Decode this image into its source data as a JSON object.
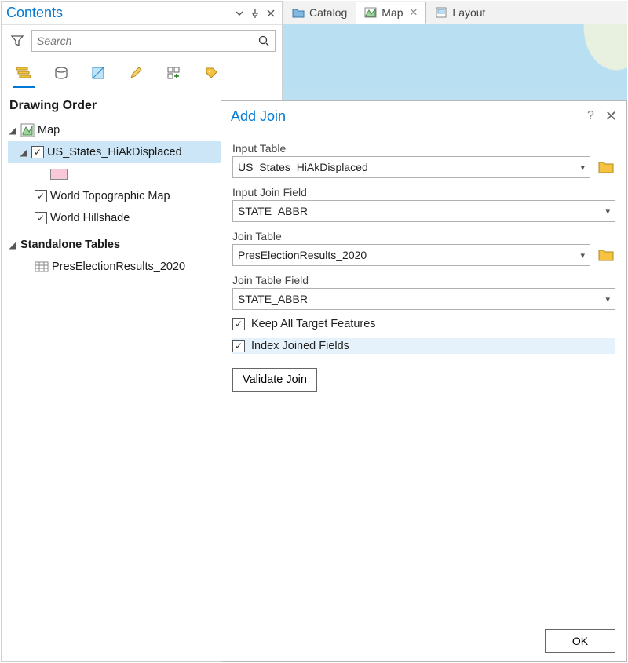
{
  "contents": {
    "title": "Contents",
    "search_placeholder": "Search",
    "drawing_order_label": "Drawing Order",
    "standalone_tables_label": "Standalone Tables",
    "map_label": "Map",
    "layers": [
      {
        "name": "US_States_HiAkDisplaced",
        "checked": true,
        "selected": true,
        "expanded": true
      },
      {
        "name": "World Topographic Map",
        "checked": true
      },
      {
        "name": "World Hillshade",
        "checked": true
      }
    ],
    "standalone_tables": [
      {
        "name": "PresElectionResults_2020"
      }
    ]
  },
  "tabs": [
    {
      "label": "Catalog",
      "icon": "catalog"
    },
    {
      "label": "Map",
      "icon": "map",
      "active": true,
      "closable": true
    },
    {
      "label": "Layout",
      "icon": "layout"
    }
  ],
  "dialog": {
    "title": "Add Join",
    "fields": {
      "input_table_label": "Input Table",
      "input_table_value": "US_States_HiAkDisplaced",
      "input_join_field_label": "Input Join Field",
      "input_join_field_value": "STATE_ABBR",
      "join_table_label": "Join Table",
      "join_table_value": "PresElectionResults_2020",
      "join_table_field_label": "Join Table Field",
      "join_table_field_value": "STATE_ABBR"
    },
    "keep_all_label": "Keep All Target Features",
    "keep_all_checked": true,
    "index_joined_label": "Index Joined Fields",
    "index_joined_checked": true,
    "validate_label": "Validate Join",
    "ok_label": "OK"
  }
}
